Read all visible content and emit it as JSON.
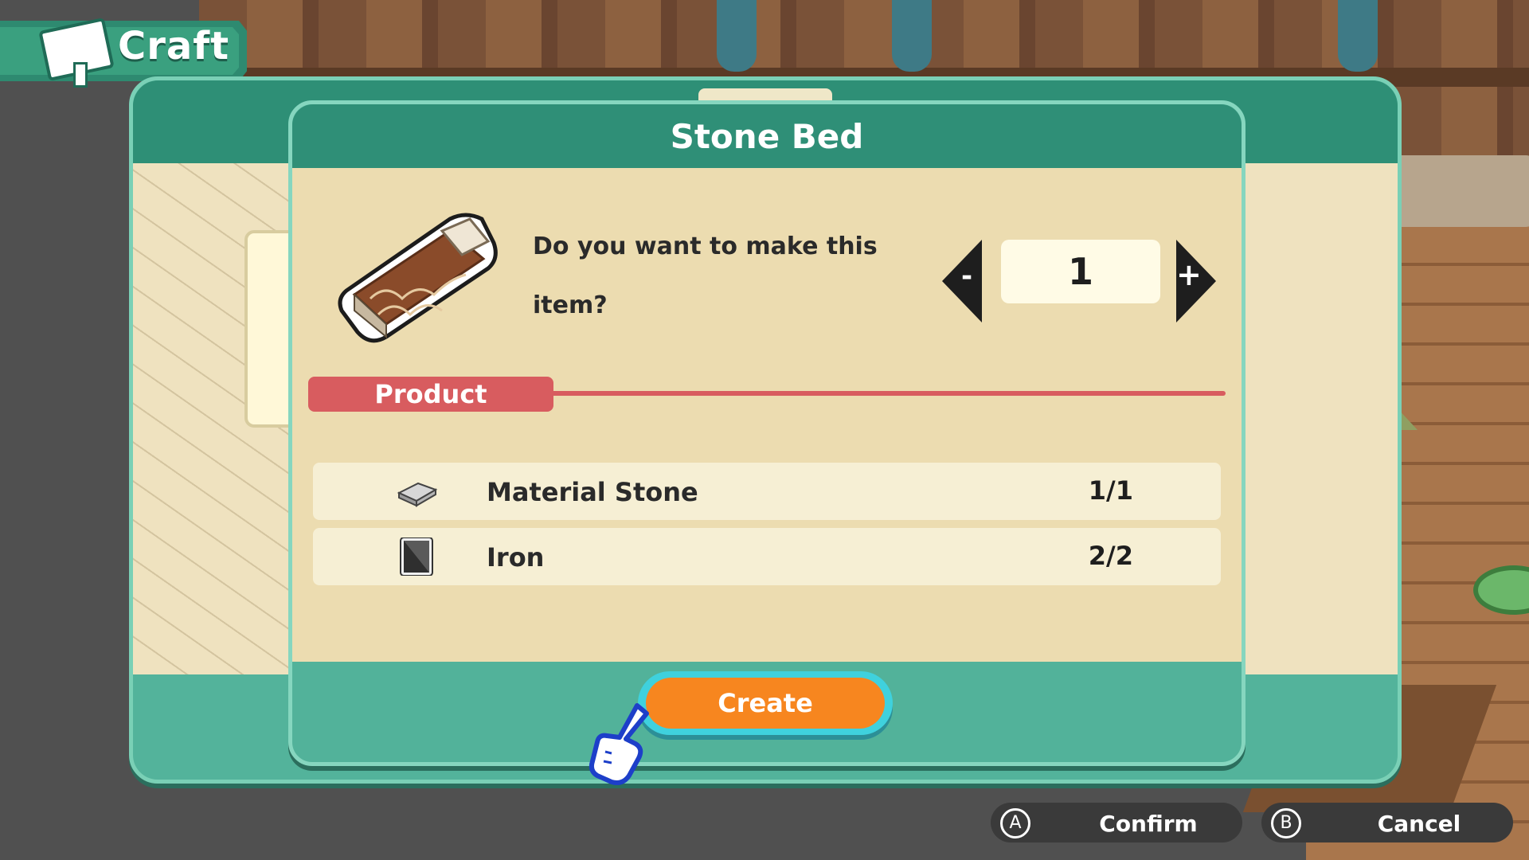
{
  "header": {
    "title": "Craft"
  },
  "dialog": {
    "title": "Stone Bed",
    "question": "Do you want to make this item?",
    "quantity": {
      "value": "1",
      "decrement_label": "-",
      "increment_label": "+"
    },
    "product_label": "Product",
    "materials": [
      {
        "name": "Material Stone",
        "count": "1/1",
        "icon": "stone-slab-icon"
      },
      {
        "name": "Iron",
        "count": "2/2",
        "icon": "iron-ingot-icon"
      }
    ],
    "create_label": "Create"
  },
  "footer": {
    "confirm": {
      "key": "A",
      "label": "Confirm"
    },
    "cancel": {
      "key": "B",
      "label": "Cancel"
    }
  },
  "colors": {
    "panel_teal": "#52b29a",
    "header_teal": "#2f8f77",
    "parchment": "#ecdcb0",
    "product_red": "#d85c5f",
    "create_orange": "#f7861f",
    "create_outline": "#3fd1dd"
  }
}
